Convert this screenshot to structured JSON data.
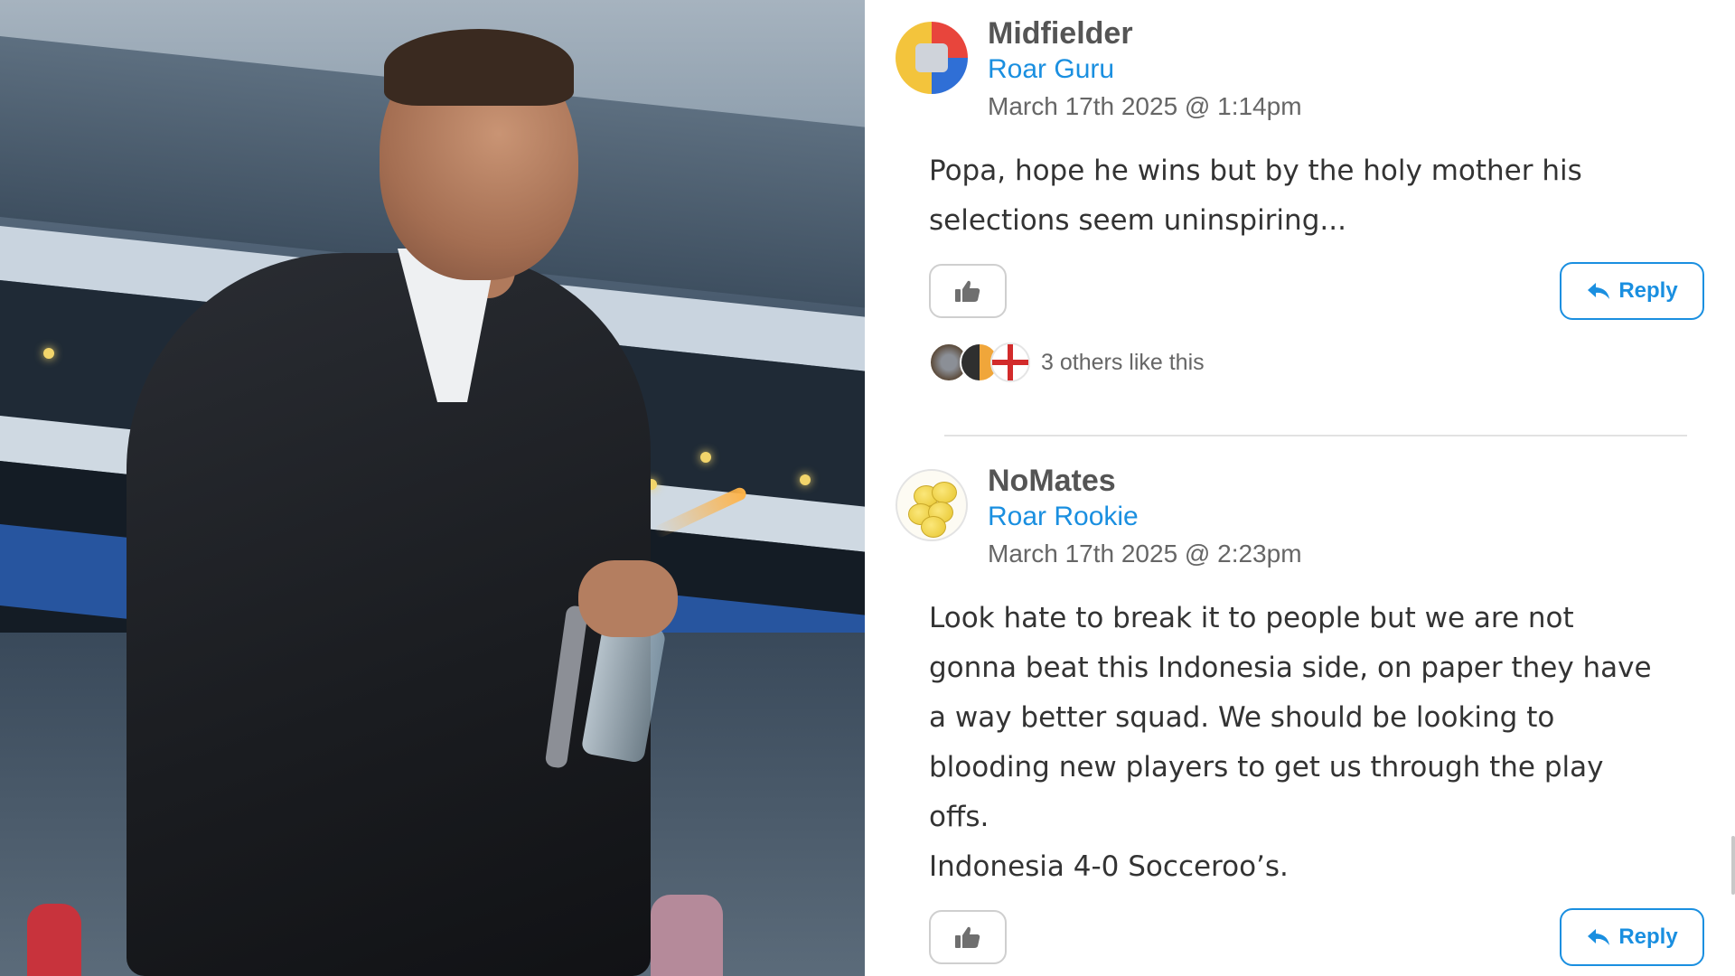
{
  "photo": {
    "description_icon": "photo-coach-stadium"
  },
  "comments": [
    {
      "author": "Midfielder",
      "rank": "Roar Guru",
      "timestamp": "March 17th 2025 @ 1:14pm",
      "body": "Popa, hope he wins but by the holy mother his\nselections seem uninspiring...",
      "like_icon": "thumbs-up-icon",
      "reply_label": "Reply",
      "reply_icon": "reply-arrow-icon",
      "likers_text": "3 others like this"
    },
    {
      "author": "NoMates",
      "rank": "Roar Rookie",
      "timestamp": "March 17th 2025 @ 2:23pm",
      "body": "Look hate to break it to people but we are not\ngonna beat this Indonesia side, on paper they have\na way better squad. We should be looking to\nblooding new players to get us through the play\noffs.\nIndonesia 4-0 Socceroo’s.",
      "like_icon": "thumbs-up-icon",
      "reply_label": "Reply",
      "reply_icon": "reply-arrow-icon"
    }
  ],
  "colors": {
    "rank": "#1a8fe0",
    "author": "#555555",
    "body": "#333333",
    "reply_border": "#1a8fe0"
  }
}
